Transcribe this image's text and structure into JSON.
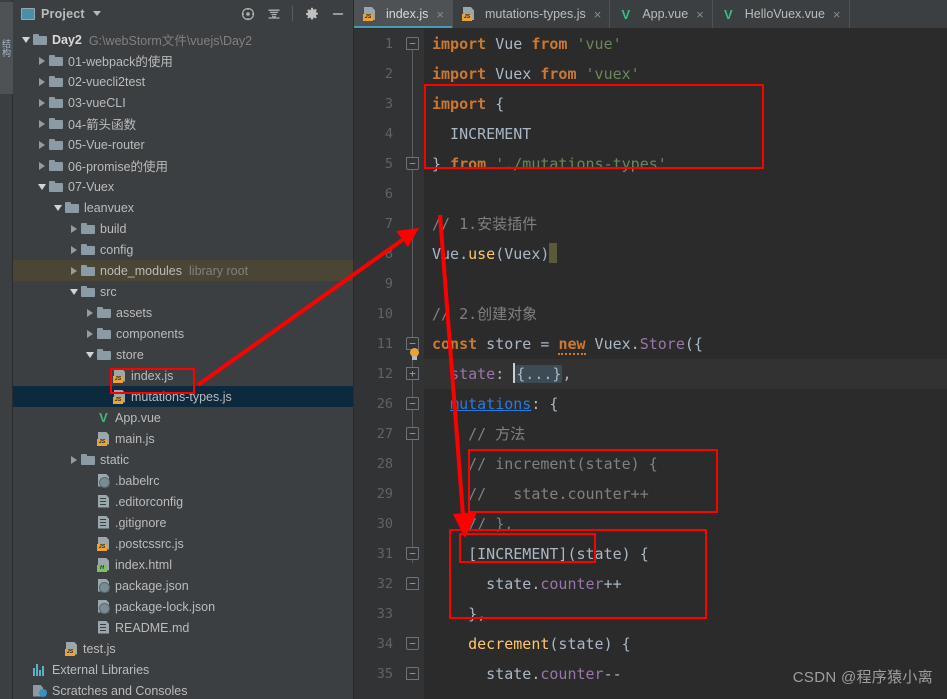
{
  "left_strip": {
    "label": "结构"
  },
  "project_panel": {
    "title": "Project",
    "icons": {
      "panel": "project-panel-icon",
      "dropdown": "chevron-down-icon",
      "locate": "locate-target-icon",
      "collapse": "collapse-all-icon",
      "settings": "gear-icon",
      "hide": "minimize-icon"
    },
    "tree": [
      {
        "indent": 0,
        "twisty": "down",
        "icon": "folder",
        "label": "Day2",
        "bold": true,
        "sub": "G:\\webStorm文件\\vuejs\\Day2"
      },
      {
        "indent": 1,
        "twisty": "right",
        "icon": "folder",
        "label": "01-webpack的使用"
      },
      {
        "indent": 1,
        "twisty": "right",
        "icon": "folder",
        "label": "02-vuecli2test"
      },
      {
        "indent": 1,
        "twisty": "right",
        "icon": "folder",
        "label": "03-vueCLI"
      },
      {
        "indent": 1,
        "twisty": "right",
        "icon": "folder",
        "label": "04-箭头函数"
      },
      {
        "indent": 1,
        "twisty": "right",
        "icon": "folder",
        "label": "05-Vue-router"
      },
      {
        "indent": 1,
        "twisty": "right",
        "icon": "folder",
        "label": "06-promise的使用"
      },
      {
        "indent": 1,
        "twisty": "down",
        "icon": "folder",
        "label": "07-Vuex"
      },
      {
        "indent": 2,
        "twisty": "down",
        "icon": "folder",
        "label": "leanvuex"
      },
      {
        "indent": 3,
        "twisty": "right",
        "icon": "folder",
        "label": "build"
      },
      {
        "indent": 3,
        "twisty": "right",
        "icon": "folder",
        "label": "config"
      },
      {
        "indent": 3,
        "twisty": "right",
        "icon": "folder",
        "label": "node_modules",
        "sub": "library root",
        "state": "highlight"
      },
      {
        "indent": 3,
        "twisty": "down",
        "icon": "folder",
        "label": "src"
      },
      {
        "indent": 4,
        "twisty": "right",
        "icon": "folder",
        "label": "assets"
      },
      {
        "indent": 4,
        "twisty": "right",
        "icon": "folder",
        "label": "components"
      },
      {
        "indent": 4,
        "twisty": "down",
        "icon": "folder",
        "label": "store"
      },
      {
        "indent": 5,
        "twisty": "none",
        "icon": "js",
        "label": "index.js",
        "boxed": true
      },
      {
        "indent": 5,
        "twisty": "none",
        "icon": "js",
        "label": "mutations-types.js",
        "state": "selected"
      },
      {
        "indent": 4,
        "twisty": "none",
        "icon": "vue",
        "label": "App.vue"
      },
      {
        "indent": 4,
        "twisty": "none",
        "icon": "js",
        "label": "main.js"
      },
      {
        "indent": 3,
        "twisty": "right",
        "icon": "folder",
        "label": "static"
      },
      {
        "indent": 4,
        "twisty": "none",
        "icon": "json",
        "label": ".babelrc"
      },
      {
        "indent": 4,
        "twisty": "none",
        "icon": "plain",
        "label": ".editorconfig"
      },
      {
        "indent": 4,
        "twisty": "none",
        "icon": "plain",
        "label": ".gitignore"
      },
      {
        "indent": 4,
        "twisty": "none",
        "icon": "js",
        "label": ".postcssrc.js"
      },
      {
        "indent": 4,
        "twisty": "none",
        "icon": "html",
        "label": "index.html"
      },
      {
        "indent": 4,
        "twisty": "none",
        "icon": "json",
        "label": "package.json"
      },
      {
        "indent": 4,
        "twisty": "none",
        "icon": "json",
        "label": "package-lock.json"
      },
      {
        "indent": 4,
        "twisty": "none",
        "icon": "plain",
        "label": "README.md"
      },
      {
        "indent": 2,
        "twisty": "none",
        "icon": "js",
        "label": "test.js"
      },
      {
        "indent": 0,
        "twisty": "none",
        "icon": "lib",
        "label": "External Libraries"
      },
      {
        "indent": 0,
        "twisty": "none",
        "icon": "scratch",
        "label": "Scratches and Consoles"
      }
    ]
  },
  "editor": {
    "tabs": [
      {
        "label": "index.js",
        "icon": "js-file-icon",
        "active": true,
        "close": "×"
      },
      {
        "label": "mutations-types.js",
        "icon": "js-file-icon",
        "active": false,
        "close": "×"
      },
      {
        "label": "App.vue",
        "icon": "vue-file-icon",
        "active": false,
        "close": "×"
      },
      {
        "label": "HelloVuex.vue",
        "icon": "vue-file-icon",
        "active": false,
        "close": "×"
      }
    ],
    "line_numbers": [
      "1",
      "2",
      "3",
      "4",
      "5",
      "6",
      "7",
      "8",
      "9",
      "10",
      "11",
      "12",
      "26",
      "27",
      "28",
      "29",
      "30",
      "31",
      "32",
      "33",
      "34",
      "35"
    ],
    "lines": [
      {
        "n": "1",
        "text": "import Vue from 'vue'"
      },
      {
        "n": "2",
        "text": "import Vuex from 'vuex'"
      },
      {
        "n": "3",
        "text": "import {"
      },
      {
        "n": "4",
        "text": "  INCREMENT"
      },
      {
        "n": "5",
        "text": "} from './mutations-types'"
      },
      {
        "n": "6",
        "text": ""
      },
      {
        "n": "7",
        "text": "// 1.安装插件"
      },
      {
        "n": "8",
        "text": "Vue.use(Vuex)"
      },
      {
        "n": "9",
        "text": ""
      },
      {
        "n": "10",
        "text": "// 2.创建对象"
      },
      {
        "n": "11",
        "text": "const store = new Vuex.Store({"
      },
      {
        "n": "12",
        "text": "  state: {...},"
      },
      {
        "n": "26",
        "text": "  mutations: {"
      },
      {
        "n": "27",
        "text": "    // 方法"
      },
      {
        "n": "28",
        "text": "    // increment(state) {"
      },
      {
        "n": "29",
        "text": "    //   state.counter++"
      },
      {
        "n": "30",
        "text": "    // },"
      },
      {
        "n": "31",
        "text": "    [INCREMENT](state) {"
      },
      {
        "n": "32",
        "text": "      state.counter++"
      },
      {
        "n": "33",
        "text": "    },"
      },
      {
        "n": "34",
        "text": "    decrement(state) {"
      },
      {
        "n": "35",
        "text": "      state.counter--"
      }
    ]
  },
  "annotations": {
    "boxes": [
      "import-block-box",
      "commented-increment-box",
      "increment-method-box",
      "increment-key-box",
      "sidebar-index-js-box"
    ],
    "arrows": [
      "arrow-to-import-block",
      "arrow-to-increment-method",
      "arrow-from-index-js"
    ]
  },
  "watermark": {
    "text": "CSDN @程序猿小离"
  },
  "colors": {
    "keyword": "#cc7832",
    "string": "#6a8759",
    "comment": "#808080",
    "identifier": "#a9b7c6",
    "class": "#9876aa",
    "function": "#ffc66d",
    "annotation_red": "#ff0000",
    "selection": "#0d293e",
    "panel_bg": "#3c3f41",
    "editor_bg": "#2b2b2b"
  }
}
